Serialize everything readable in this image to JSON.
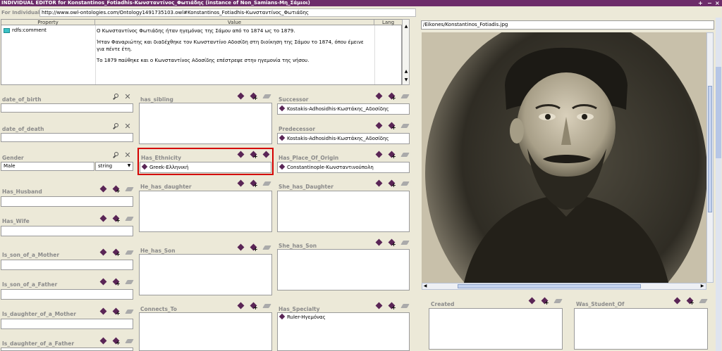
{
  "window": {
    "title": "INDIVIDUAL EDITOR for Konstantinos_Fotiadhis-Κωνσταντίνος_Φωτιάδης  (instance of Non_Samians-Μη_Σάμιοι)",
    "controls": [
      "+",
      "−",
      "×"
    ]
  },
  "individual": {
    "label": "For Individual:",
    "uri": "http://www.owl-ontologies.com/Ontology1491735103.owl#Konstantinos_Fotiadhis-Κωνσταντίνος_Φωτιάδης"
  },
  "annotations": {
    "headers": [
      "Property",
      "Value",
      "Lang"
    ],
    "row": {
      "property": "rdfs:comment",
      "value": [
        "Ο Κωνσταντίνος Φωτιάδης ήταν ηγεμόνας της Σάμου από το 1874 ως το 1879.",
        "Ήταν Φαναριώτης και διαδέχθηκε τον Κωνσταντίνο Αδοσίδη στη διοίκηση της Σάμου το 1874, όπου έμεινε για πέντε έτη.",
        "Το 1879 παύθηκε και ο Κωνσταντίνος Αδοσίδης επέστρεψε στην ηγεμονία της νήσου."
      ],
      "lang": ""
    }
  },
  "col1": {
    "date_of_birth": {
      "label": "date_of_birth",
      "value": ""
    },
    "date_of_death": {
      "label": "date_of_death",
      "value": ""
    },
    "gender": {
      "label": "Gender",
      "value": "Male",
      "type": "string"
    },
    "has_husband": {
      "label": "Has_Husband",
      "value": ""
    },
    "has_wife": {
      "label": "Has_Wife",
      "value": ""
    },
    "son_of_mother": {
      "label": "Is_son_of_a_Mother",
      "value": ""
    },
    "son_of_father": {
      "label": "Is_son_of_a_Father",
      "value": ""
    },
    "daughter_of_mother": {
      "label": "Is_daughter_of_a_Mother",
      "value": ""
    },
    "daughter_of_father": {
      "label": "Is_daughter_of_a_Father",
      "value": ""
    }
  },
  "col2": {
    "has_sibling": {
      "label": "has_sibling"
    },
    "has_ethnicity": {
      "label": "Has_Ethnicity",
      "items": [
        "Greek-Ελληνική"
      ]
    },
    "he_has_daughter": {
      "label": "He_has_daughter"
    },
    "he_has_son": {
      "label": "He_has_Son"
    },
    "connects_to": {
      "label": "Connects_To"
    }
  },
  "col3": {
    "successor": {
      "label": "Successor",
      "items": [
        "Kostakis-Adhosidhis-Κωστάκης_Αδοσίδης"
      ]
    },
    "predecessor": {
      "label": "Predecessor",
      "items": [
        "Kostakis-Adhosidhis-Κωστάκης_Αδοσίδης"
      ]
    },
    "place_of_origin": {
      "label": "Has_Place_Of_Origin",
      "items": [
        "Constantinople-Κωνσταντινούπολη"
      ]
    },
    "she_has_daughter": {
      "label": "She_has_Daughter"
    },
    "she_has_son": {
      "label": "She_has_Son"
    },
    "has_specialty": {
      "label": "Has_Specialty",
      "items": [
        "Ruler-Ηγεμόνας"
      ]
    }
  },
  "image": {
    "path": "/Eikones/Konstantinos_Fotiadis.jpg"
  },
  "bottom_right": {
    "created": {
      "label": "Created"
    },
    "was_student_of": {
      "label": "Was_Student_Of"
    }
  },
  "icons": {
    "instance": "instance-diamond-icon",
    "add": "add-instance-icon",
    "remove": "remove-instance-icon",
    "search": "search-icon",
    "delete": "delete-icon"
  },
  "colors": {
    "title_bar": "#6d2c6a",
    "instance_icon": "#5a2556",
    "highlight": "#d40000",
    "label": "#8a8a8a"
  }
}
